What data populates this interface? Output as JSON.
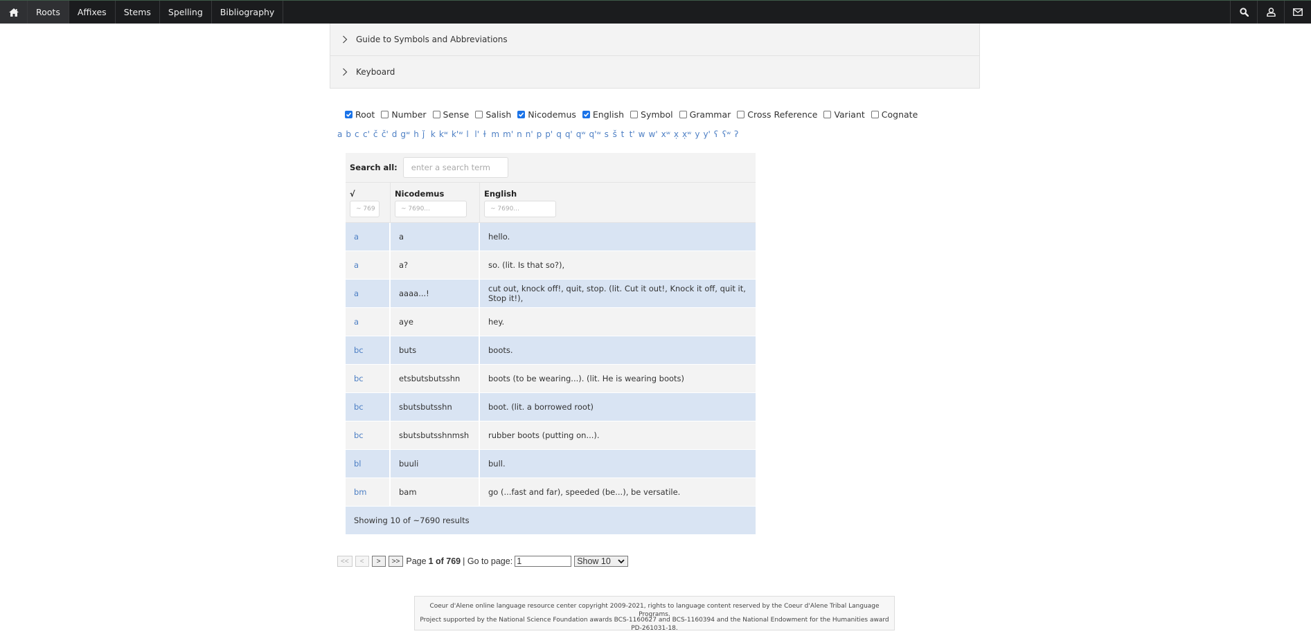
{
  "nav": {
    "home_icon": "home-icon",
    "items": [
      {
        "label": "Roots",
        "active": true
      },
      {
        "label": "Affixes",
        "active": false
      },
      {
        "label": "Stems",
        "active": false
      },
      {
        "label": "Spelling",
        "active": false
      },
      {
        "label": "Bibliography",
        "active": false
      }
    ],
    "right_icons": [
      "search-icon",
      "user-icon",
      "mail-icon"
    ]
  },
  "accordions": [
    {
      "label": "Guide to Symbols and Abbreviations",
      "expanded": false
    },
    {
      "label": "Keyboard",
      "expanded": false
    }
  ],
  "field_toggles": [
    {
      "label": "Root",
      "checked": true
    },
    {
      "label": "Number",
      "checked": false
    },
    {
      "label": "Sense",
      "checked": false
    },
    {
      "label": "Salish",
      "checked": false
    },
    {
      "label": "Nicodemus",
      "checked": true
    },
    {
      "label": "English",
      "checked": true
    },
    {
      "label": "Symbol",
      "checked": false
    },
    {
      "label": "Grammar",
      "checked": false
    },
    {
      "label": "Cross Reference",
      "checked": false
    },
    {
      "label": "Variant",
      "checked": false
    },
    {
      "label": "Cognate",
      "checked": false
    }
  ],
  "alphabet": [
    "a",
    "b",
    "c",
    "c'",
    "č",
    "č'",
    "d",
    "gʷ",
    "h",
    "ǰ",
    "k",
    "kʷ",
    "k'ʷ",
    "l",
    "l'",
    "ɫ",
    "m",
    "m'",
    "n",
    "n'",
    "p",
    "p'",
    "q",
    "q'",
    "qʷ",
    "q'ʷ",
    "s",
    "š",
    "t",
    "t'",
    "w",
    "w'",
    "xʷ",
    "x̣",
    "x̣ʷ",
    "y",
    "y'",
    "ʕ",
    "ʕʷ",
    "ʔ"
  ],
  "search": {
    "label": "Search all:",
    "placeholder": "enter a search term"
  },
  "table": {
    "columns": [
      {
        "label": "√",
        "filter_placeholder": "~ 769"
      },
      {
        "label": "Nicodemus",
        "filter_placeholder": "~ 7690..."
      },
      {
        "label": "English",
        "filter_placeholder": "~ 7690..."
      }
    ],
    "rows": [
      {
        "root": "a",
        "nicodemus": "a",
        "english": "hello."
      },
      {
        "root": "a",
        "nicodemus": "a?",
        "english": "so. (lit. Is that so?),"
      },
      {
        "root": "a",
        "nicodemus": "aaaa...!",
        "english": "cut out, knock off!, quit, stop. (lit. Cut it out!, Knock it off, quit it, Stop it!),"
      },
      {
        "root": "a",
        "nicodemus": "aye",
        "english": "hey."
      },
      {
        "root": "bc",
        "nicodemus": "buts",
        "english": "boots."
      },
      {
        "root": "bc",
        "nicodemus": "etsbutsbutsshn",
        "english": "boots (to be wearing...). (lit. He is wearing boots)"
      },
      {
        "root": "bc",
        "nicodemus": "sbutsbutsshn",
        "english": "boot. (lit. a borrowed root)"
      },
      {
        "root": "bc",
        "nicodemus": "sbutsbutsshnmsh",
        "english": "rubber boots (putting on...)."
      },
      {
        "root": "bl",
        "nicodemus": "buuli",
        "english": "bull."
      },
      {
        "root": "bm",
        "nicodemus": "bam",
        "english": "go (...fast and far), speeded (be...), be versatile."
      }
    ],
    "summary": "Showing 10 of ~7690 results"
  },
  "pagination": {
    "first": "<<",
    "prev": "<",
    "next": ">",
    "last": ">>",
    "page_prefix": "Page",
    "page_current": "1 of 769",
    "goto_label": "| Go to page:",
    "goto_value": "1",
    "page_size": "Show 10"
  },
  "footer": {
    "line1": "Coeur d'Alene online language resource center copyright 2009-2021, rights to language content reserved by the Coeur d'Alene Tribal Language Programs.",
    "line2": "Project supported by the National Science Foundation awards BCS-1160627 and BCS-1160394 and the National Endowment for the Humanities award PD-261031-18."
  }
}
